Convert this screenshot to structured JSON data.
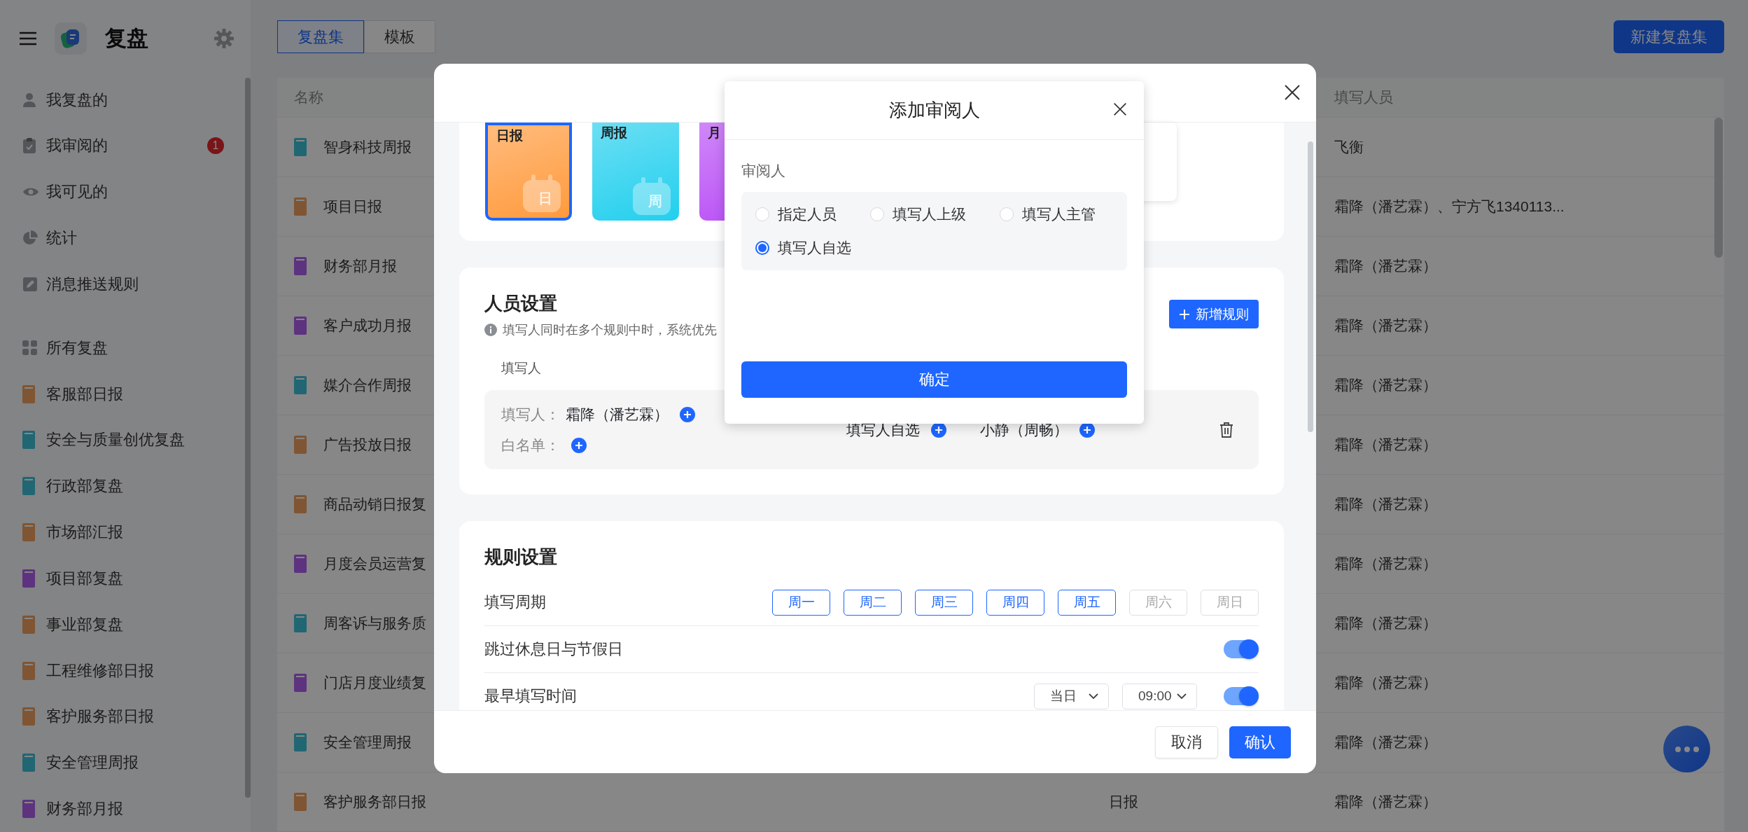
{
  "sidebar": {
    "title": "复盘",
    "nav": [
      {
        "kind": "person",
        "label": "我复盘的"
      },
      {
        "kind": "clipboard",
        "label": "我审阅的",
        "badge": "1"
      },
      {
        "kind": "eye",
        "label": "我可见的"
      },
      {
        "kind": "pie",
        "label": "统计"
      },
      {
        "kind": "edit",
        "label": "消息推送规则"
      }
    ],
    "all_label": "所有复盘",
    "collections": [
      {
        "label": "客服部日报",
        "color": "#7f5533"
      },
      {
        "label": "安全与质量创优复盘",
        "color": "#216673"
      },
      {
        "label": "行政部复盘",
        "color": "#216673"
      },
      {
        "label": "市场部汇报",
        "color": "#7f5533"
      },
      {
        "label": "项目部复盘",
        "color": "#5d337f"
      },
      {
        "label": "事业部复盘",
        "color": "#7f5533"
      },
      {
        "label": "工程维修部日报",
        "color": "#7f5533"
      },
      {
        "label": "客护服务部日报",
        "color": "#7f5533"
      },
      {
        "label": "安全管理周报",
        "color": "#216673"
      },
      {
        "label": "财务部月报",
        "color": "#5d337f"
      }
    ]
  },
  "main": {
    "tabs": [
      {
        "label": "复盘集",
        "selected": true
      },
      {
        "label": "模板",
        "selected": false
      }
    ],
    "new_button": "新建复盘集",
    "table": {
      "columns": [
        "名称",
        "填写人员"
      ],
      "rows": [
        {
          "name": "智身科技周报",
          "color": "#216673",
          "members": "飞衡"
        },
        {
          "name": "项目日报",
          "color": "#7f5533",
          "members": "霜降（潘艺霖）、宁方飞1340113..."
        },
        {
          "name": "财务部月报",
          "color": "#5d337f",
          "members": "霜降（潘艺霖）"
        },
        {
          "name": "客户成功月报",
          "color": "#5d337f",
          "members": "霜降（潘艺霖）"
        },
        {
          "name": "媒介合作周报",
          "color": "#216673",
          "members": "霜降（潘艺霖）"
        },
        {
          "name": "广告投放日报",
          "color": "#7f5533",
          "members": "霜降（潘艺霖）"
        },
        {
          "name": "商品动销日报复",
          "color": "#7f5533",
          "members": "霜降（潘艺霖）"
        },
        {
          "name": "月度会员运营复",
          "color": "#5d337f",
          "members": "霜降（潘艺霖）"
        },
        {
          "name": "周客诉与服务质",
          "color": "#216673",
          "members": "霜降（潘艺霖）"
        },
        {
          "name": "门店月度业绩复",
          "color": "#5d337f",
          "members": "霜降（潘艺霖）"
        },
        {
          "name": "安全管理周报",
          "color": "#216673",
          "members": "霜降（潘艺霖）"
        },
        {
          "name": "客护服务部日报",
          "color": "#7f5533",
          "column_2": "日报",
          "members": "霜降（潘艺霖）"
        }
      ]
    }
  },
  "dialog": {
    "templates": [
      {
        "label": "日报",
        "glyph": "日",
        "color": "#ff9a3c",
        "selected": true
      },
      {
        "label": "周报",
        "glyph": "周",
        "color": "#22cfee",
        "selected": false
      },
      {
        "label": "月",
        "color": "#b84cf6",
        "selected": false
      }
    ],
    "people": {
      "title": "人员设置",
      "hint": "填写人同时在多个规则中时，系统优先",
      "add_button": "新增规则",
      "column": "填写人",
      "rule": {
        "filler_label": "填写人：",
        "filler": "霜降（潘艺霖）",
        "whitelist_label": "白名单：",
        "reviewer_mode": "填写人自选",
        "reviewer": "小静（周畅）"
      }
    },
    "rules": {
      "title": "规则设置",
      "rows": [
        {
          "kind": "weekdays",
          "label": "填写周期",
          "days": [
            {
              "label": "周一",
              "selected": true
            },
            {
              "label": "周二",
              "selected": true
            },
            {
              "label": "周三",
              "selected": true
            },
            {
              "label": "周四",
              "selected": true
            },
            {
              "label": "周五",
              "selected": true
            },
            {
              "label": "周六",
              "selected": false
            },
            {
              "label": "周日",
              "selected": false
            }
          ]
        },
        {
          "kind": "toggle",
          "label": "跳过休息日与节假日",
          "on": true
        },
        {
          "kind": "time",
          "label": "最早填写时间",
          "selects": [
            "当日",
            "09:00"
          ],
          "on": true
        }
      ]
    },
    "cancel": "取消",
    "confirm": "确认"
  },
  "popup": {
    "title": "添加审阅人",
    "label": "审阅人",
    "options": [
      {
        "label": "指定人员",
        "selected": false
      },
      {
        "label": "填写人上级",
        "selected": false
      },
      {
        "label": "填写人主管",
        "selected": false
      },
      {
        "label": "填写人自选",
        "selected": true
      }
    ],
    "button": "确定"
  }
}
